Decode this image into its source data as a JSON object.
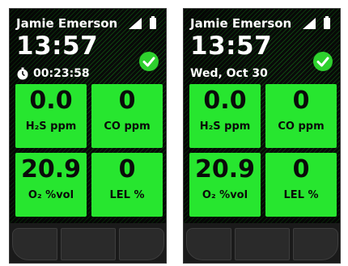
{
  "screens": [
    {
      "user": "Jamie Emerson",
      "time": "13:57",
      "subline": "00:23:58",
      "subline_icon": "stopwatch-icon",
      "status_icon": "check-icon",
      "readings": [
        {
          "value": "0.0",
          "unit": "H₂S ppm"
        },
        {
          "value": "0",
          "unit": "CO ppm"
        },
        {
          "value": "20.9",
          "unit": "O₂ %vol"
        },
        {
          "value": "0",
          "unit": "LEL %"
        }
      ]
    },
    {
      "user": "Jamie Emerson",
      "time": "13:57",
      "subline": "Wed, Oct 30",
      "status_icon": "check-icon",
      "readings": [
        {
          "value": "0.0",
          "unit": "H₂S ppm"
        },
        {
          "value": "0",
          "unit": "CO ppm"
        },
        {
          "value": "20.9",
          "unit": "O₂ %vol"
        },
        {
          "value": "0",
          "unit": "LEL %"
        }
      ]
    }
  ],
  "colors": {
    "tile_green": "#27e62f",
    "status_green": "#2ed12e",
    "background": "#0b0b0b",
    "text": "#ffffff"
  }
}
